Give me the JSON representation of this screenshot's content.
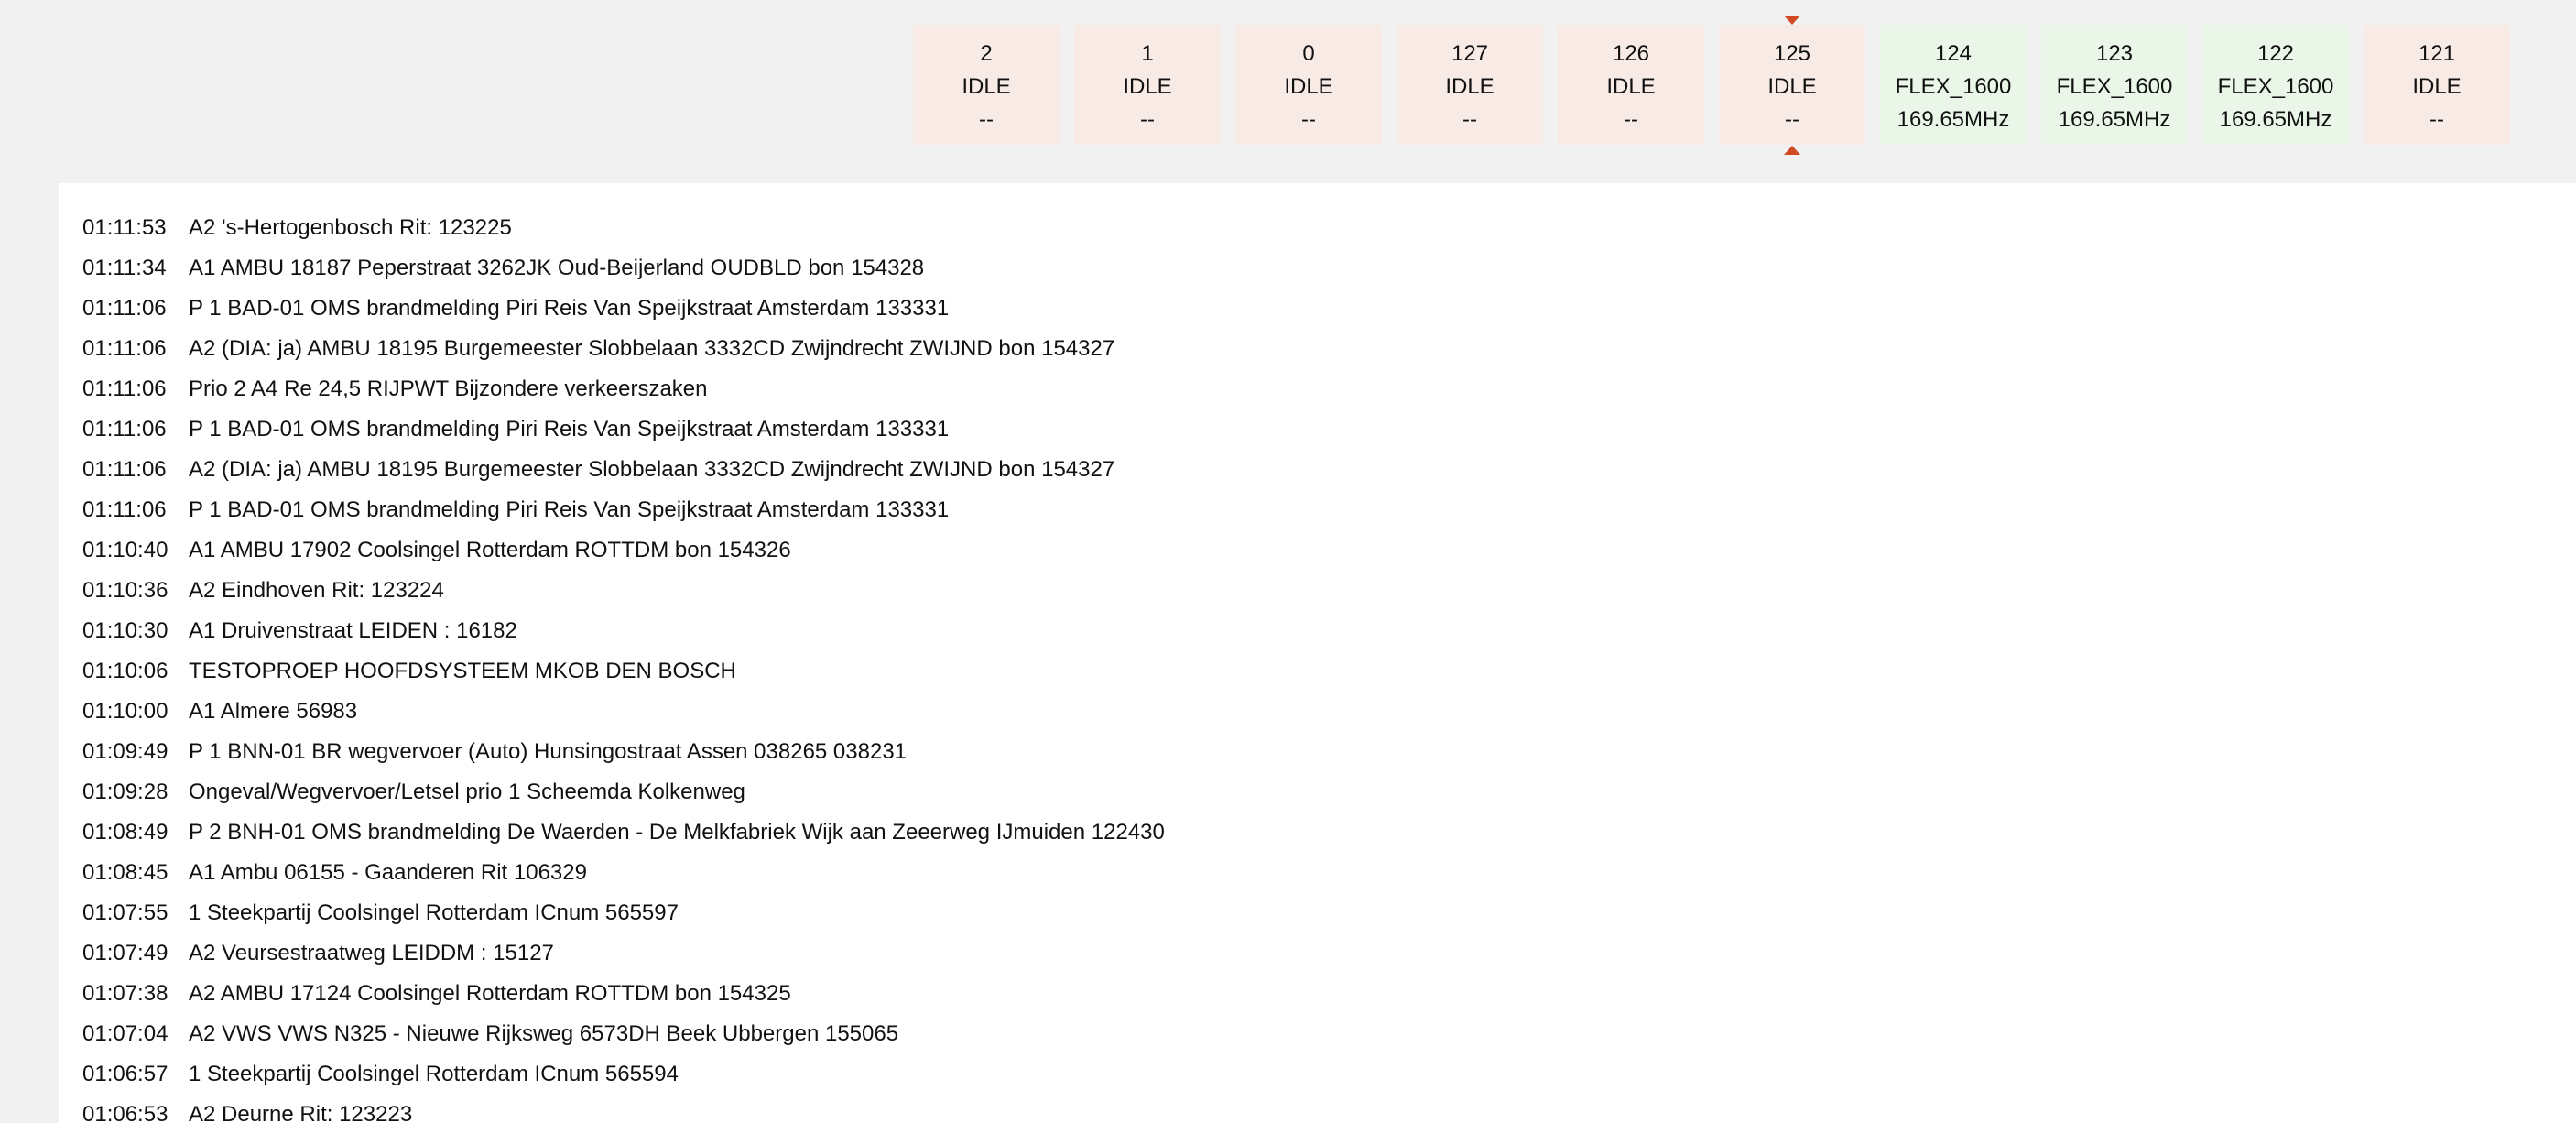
{
  "channels": [
    {
      "id": "2",
      "status": "IDLE",
      "freq": "--",
      "kind": "idle"
    },
    {
      "id": "1",
      "status": "IDLE",
      "freq": "--",
      "kind": "idle"
    },
    {
      "id": "0",
      "status": "IDLE",
      "freq": "--",
      "kind": "idle"
    },
    {
      "id": "127",
      "status": "IDLE",
      "freq": "--",
      "kind": "idle"
    },
    {
      "id": "126",
      "status": "IDLE",
      "freq": "--",
      "kind": "idle"
    },
    {
      "id": "125",
      "status": "IDLE",
      "freq": "--",
      "kind": "idle",
      "selected": true
    },
    {
      "id": "124",
      "status": "FLEX_1600",
      "freq": "169.65MHz",
      "kind": "flex"
    },
    {
      "id": "123",
      "status": "FLEX_1600",
      "freq": "169.65MHz",
      "kind": "flex"
    },
    {
      "id": "122",
      "status": "FLEX_1600",
      "freq": "169.65MHz",
      "kind": "flex"
    },
    {
      "id": "121",
      "status": "IDLE",
      "freq": "--",
      "kind": "idle"
    }
  ],
  "colors": {
    "idle_bg": "#f8ebe6",
    "flex_bg": "#e9f6e8",
    "marker": "#d04a24",
    "page_bg": "#f1f1f1",
    "log_bg": "#ffffff"
  },
  "icons": {
    "selected_top": "triangle-down-icon",
    "selected_bottom": "triangle-up-icon"
  },
  "log": [
    {
      "time": "01:11:53",
      "msg": "A2 's-Hertogenbosch Rit: 123225"
    },
    {
      "time": "01:11:34",
      "msg": "A1 AMBU 18187 Peperstraat 3262JK Oud-Beijerland OUDBLD bon 154328"
    },
    {
      "time": "01:11:06",
      "msg": "P 1 BAD-01 OMS brandmelding Piri Reis Van Speijkstraat Amsterdam 133331"
    },
    {
      "time": "01:11:06",
      "msg": "A2 (DIA: ja) AMBU 18195 Burgemeester Slobbelaan 3332CD Zwijndrecht ZWIJND bon 154327"
    },
    {
      "time": "01:11:06",
      "msg": "Prio 2 A4 Re 24,5 RIJPWT Bijzondere verkeerszaken"
    },
    {
      "time": "01:11:06",
      "msg": "P 1 BAD-01 OMS brandmelding Piri Reis Van Speijkstraat Amsterdam 133331"
    },
    {
      "time": "01:11:06",
      "msg": "A2 (DIA: ja) AMBU 18195 Burgemeester Slobbelaan 3332CD Zwijndrecht ZWIJND bon 154327"
    },
    {
      "time": "01:11:06",
      "msg": "P 1 BAD-01 OMS brandmelding Piri Reis Van Speijkstraat Amsterdam 133331"
    },
    {
      "time": "01:10:40",
      "msg": "A1 AMBU 17902 Coolsingel Rotterdam ROTTDM bon 154326"
    },
    {
      "time": "01:10:36",
      "msg": "A2 Eindhoven Rit: 123224"
    },
    {
      "time": "01:10:30",
      "msg": "A1 Druivenstraat LEIDEN : 16182"
    },
    {
      "time": "01:10:06",
      "msg": "TESTOPROEP HOOFDSYSTEEM MKOB DEN BOSCH"
    },
    {
      "time": "01:10:00",
      "msg": "A1 Almere 56983"
    },
    {
      "time": "01:09:49",
      "msg": "P 1 BNN-01 BR wegvervoer (Auto) Hunsingostraat Assen 038265 038231"
    },
    {
      "time": "01:09:28",
      "msg": "Ongeval/Wegvervoer/Letsel prio 1 Scheemda Kolkenweg"
    },
    {
      "time": "01:08:49",
      "msg": "P 2 BNH-01 OMS brandmelding De Waerden - De Melkfabriek Wijk aan Zeeerweg IJmuiden 122430"
    },
    {
      "time": "01:08:45",
      "msg": "A1 Ambu 06155 - Gaanderen Rit 106329"
    },
    {
      "time": "01:07:55",
      "msg": "1 Steekpartij Coolsingel Rotterdam ICnum 565597"
    },
    {
      "time": "01:07:49",
      "msg": "A2 Veursestraatweg LEIDDM : 15127"
    },
    {
      "time": "01:07:38",
      "msg": "A2 AMBU 17124 Coolsingel Rotterdam ROTTDM bon 154325"
    },
    {
      "time": "01:07:04",
      "msg": "A2 VWS VWS N325 - Nieuwe Rijksweg 6573DH Beek Ubbergen 155065"
    },
    {
      "time": "01:06:57",
      "msg": "1 Steekpartij Coolsingel Rotterdam ICnum 565594"
    },
    {
      "time": "01:06:53",
      "msg": "A2 Deurne Rit: 123223"
    }
  ]
}
